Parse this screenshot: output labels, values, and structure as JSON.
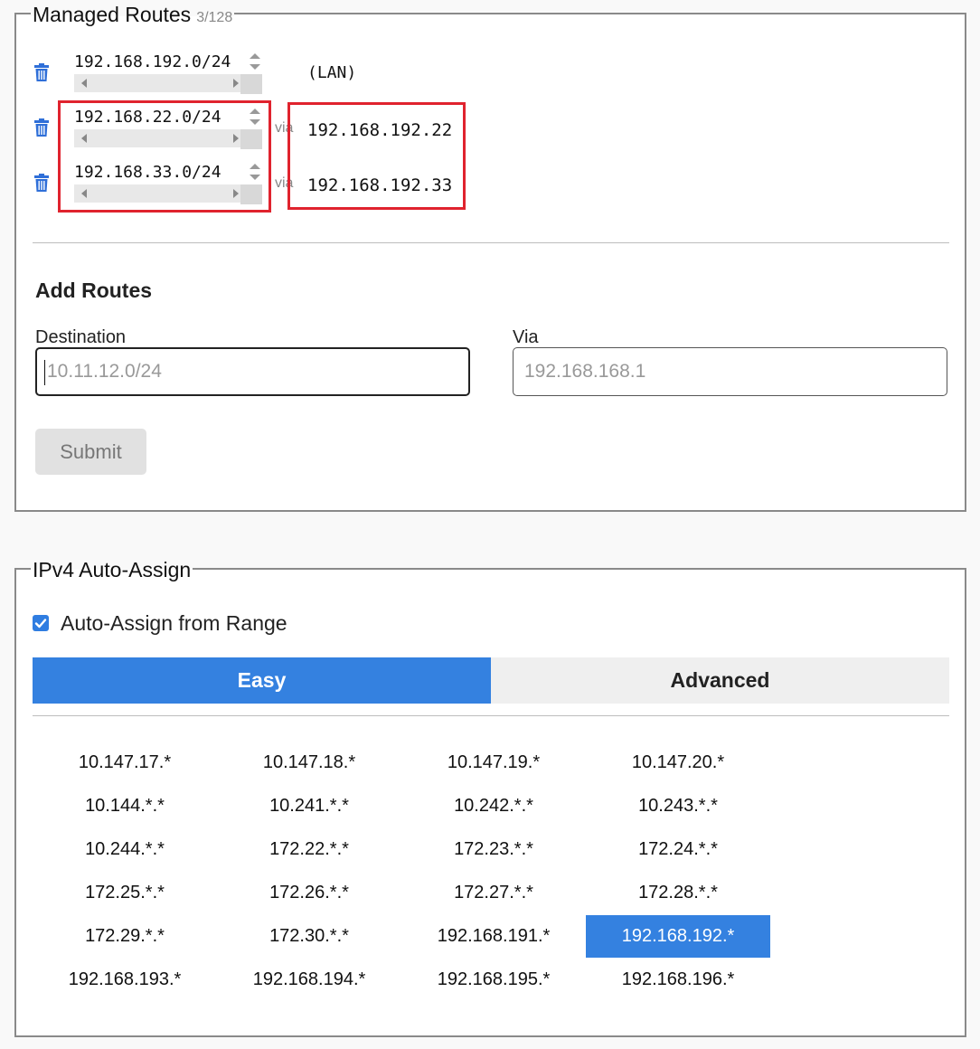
{
  "managed_routes": {
    "legend": "Managed Routes",
    "count": "3/128",
    "routes": [
      {
        "destination": "192.168.192.0/24",
        "via_label": "",
        "via": "",
        "note": "(LAN)"
      },
      {
        "destination": "192.168.22.0/24",
        "via_label": "via",
        "via": "192.168.192.22",
        "note": ""
      },
      {
        "destination": "192.168.33.0/24",
        "via_label": "via",
        "via": "192.168.192.33",
        "note": ""
      }
    ]
  },
  "add_routes": {
    "heading": "Add Routes",
    "destination_label": "Destination",
    "destination_placeholder": "10.11.12.0/24",
    "via_label": "Via",
    "via_placeholder": "192.168.168.1",
    "submit_label": "Submit"
  },
  "ipv4_auto_assign": {
    "legend": "IPv4 Auto-Assign",
    "checkbox_label": "Auto-Assign from Range",
    "checkbox_checked": true,
    "tabs": [
      {
        "label": "Easy",
        "active": true
      },
      {
        "label": "Advanced",
        "active": false
      }
    ],
    "ranges": [
      [
        "10.147.17.*",
        "10.147.18.*",
        "10.147.19.*",
        "10.147.20.*"
      ],
      [
        "10.144.*.*",
        "10.241.*.*",
        "10.242.*.*",
        "10.243.*.*"
      ],
      [
        "10.244.*.*",
        "172.22.*.*",
        "172.23.*.*",
        "172.24.*.*"
      ],
      [
        "172.25.*.*",
        "172.26.*.*",
        "172.27.*.*",
        "172.28.*.*"
      ],
      [
        "172.29.*.*",
        "172.30.*.*",
        "192.168.191.*",
        "192.168.192.*"
      ],
      [
        "192.168.193.*",
        "192.168.194.*",
        "192.168.195.*",
        "192.168.196.*"
      ]
    ],
    "selected_range": "192.168.192.*"
  },
  "colors": {
    "accent": "#3481e0",
    "highlight_box": "#e0232e",
    "trash_icon": "#2f6fd8"
  }
}
